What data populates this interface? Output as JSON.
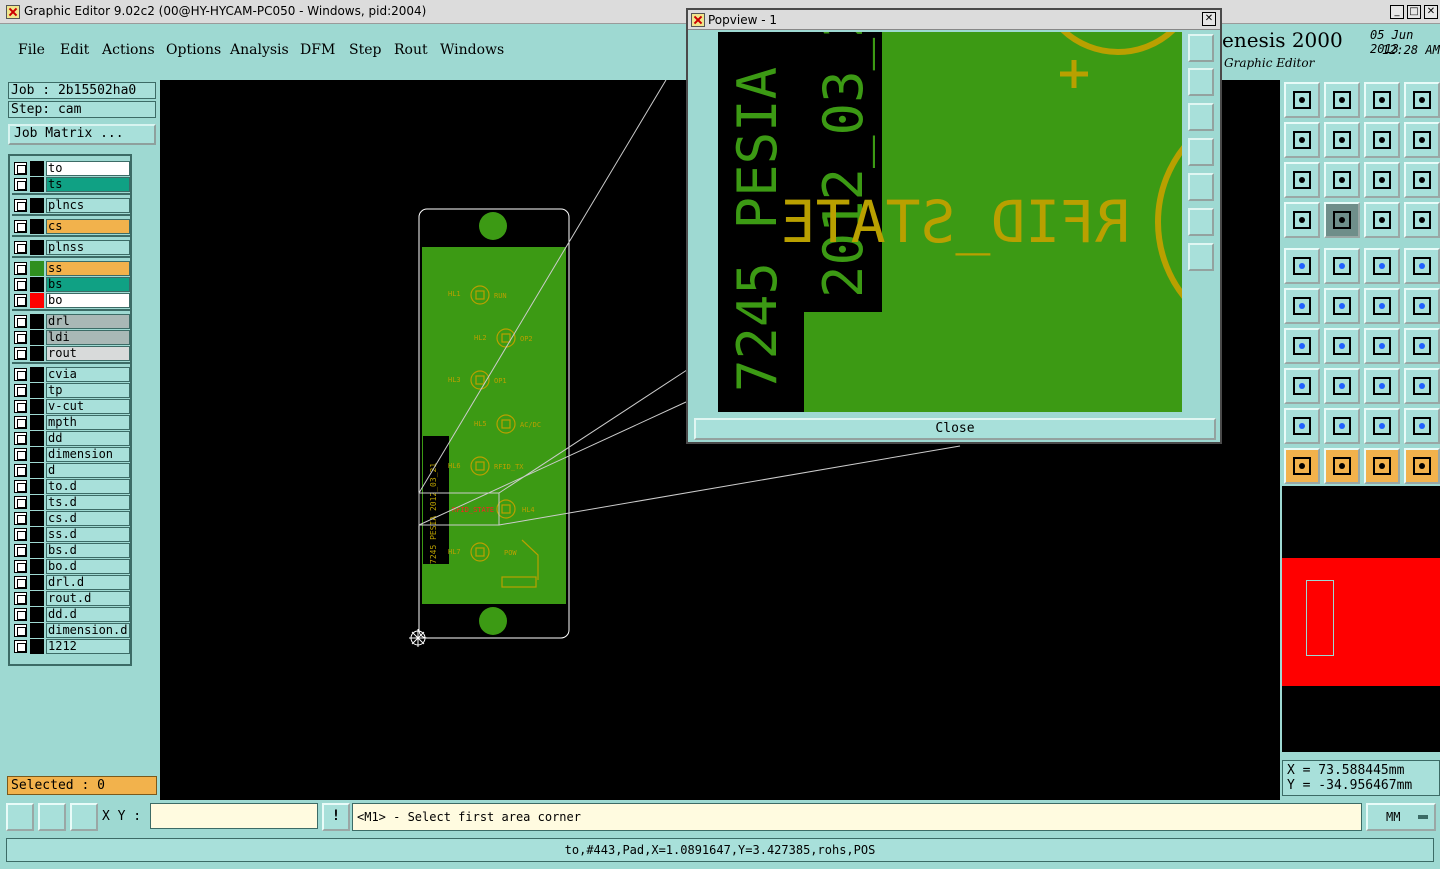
{
  "window": {
    "title": "Graphic Editor 9.02c2 (00@HY-HYCAM-PC050 - Windows, pid:2004)",
    "min": "_",
    "max": "□",
    "close": "✕"
  },
  "menu": {
    "items": [
      "File",
      "Edit",
      "Actions",
      "Options",
      "Analysis",
      "DFM",
      "Step",
      "Rout",
      "Windows"
    ]
  },
  "brand": {
    "name": "enesis 2000",
    "sub": "Graphic Editor",
    "date": "05 Jun 2013",
    "time": "12:28 AM"
  },
  "left": {
    "job": "Job : 2b15502ha0",
    "step": "Step: cam",
    "job_matrix": "Job Matrix ...",
    "selected": "Selected : 0"
  },
  "layers": [
    {
      "name": "to",
      "color": "#000000",
      "bg": "#ffffff"
    },
    {
      "name": "ts",
      "color": "#000000",
      "bg": "#10a184"
    },
    {
      "name": "plncs",
      "color": "#000000",
      "bg": "#a8e0da"
    },
    {
      "name": "cs",
      "color": "#000000",
      "bg": "#f2b24c"
    },
    {
      "name": "plnss",
      "color": "#000000",
      "bg": "#a8e0da"
    },
    {
      "name": "ss",
      "color": "#2f8f1f",
      "bg": "#f2b24c"
    },
    {
      "name": "bs",
      "color": "#000000",
      "bg": "#10a184"
    },
    {
      "name": "bo",
      "color": "#ff0000",
      "bg": "#ffffff"
    },
    {
      "name": "drl",
      "color": "#000000",
      "bg": "#a9b8b6"
    },
    {
      "name": "ldi",
      "color": "#000000",
      "bg": "#a9b8b6"
    },
    {
      "name": "rout",
      "color": "#000000",
      "bg": "#d8dada"
    },
    {
      "name": "cvia",
      "color": "#000000",
      "bg": "#a8e0da"
    },
    {
      "name": "tp",
      "color": "#000000",
      "bg": "#a8e0da"
    },
    {
      "name": "v-cut",
      "color": "#000000",
      "bg": "#a8e0da"
    },
    {
      "name": "mpth",
      "color": "#000000",
      "bg": "#a8e0da"
    },
    {
      "name": "dd",
      "color": "#000000",
      "bg": "#a8e0da"
    },
    {
      "name": "dimension",
      "color": "#000000",
      "bg": "#a8e0da"
    },
    {
      "name": "d",
      "color": "#000000",
      "bg": "#a8e0da"
    },
    {
      "name": "to.d",
      "color": "#000000",
      "bg": "#a8e0da"
    },
    {
      "name": "ts.d",
      "color": "#000000",
      "bg": "#a8e0da"
    },
    {
      "name": "cs.d",
      "color": "#000000",
      "bg": "#a8e0da"
    },
    {
      "name": "ss.d",
      "color": "#000000",
      "bg": "#a8e0da"
    },
    {
      "name": "bs.d",
      "color": "#000000",
      "bg": "#a8e0da"
    },
    {
      "name": "bo.d",
      "color": "#000000",
      "bg": "#a8e0da"
    },
    {
      "name": "drl.d",
      "color": "#000000",
      "bg": "#a8e0da"
    },
    {
      "name": "rout.d",
      "color": "#000000",
      "bg": "#a8e0da"
    },
    {
      "name": "dd.d",
      "color": "#000000",
      "bg": "#a8e0da"
    },
    {
      "name": "dimension.d",
      "color": "#000000",
      "bg": "#a8e0da"
    },
    {
      "name": "1212",
      "color": "#000000",
      "bg": "#a8e0da"
    }
  ],
  "board": {
    "silk": [
      "RUN",
      "OP2",
      "OP1",
      "AC/DC",
      "RFID_TX",
      "RFID_STATE",
      "POW"
    ],
    "refs": [
      "HL1",
      "HL2",
      "HL3",
      "HL5",
      "HL6",
      "HL4",
      "HL7"
    ],
    "vert_text": [
      "7245 PESIA 2012_03_21",
      "2012_03_21"
    ]
  },
  "popview": {
    "title": "Popview - 1",
    "close": "Close",
    "text_vert1": "7245 PESIA",
    "text_vert2": "2012_03_21",
    "mirror_text": "RFID_STATE"
  },
  "coords": {
    "x": "X = 73.588445mm",
    "y": "Y = -34.956467mm"
  },
  "cmd": {
    "xy_label": "X Y :",
    "xy_value": "",
    "prompt": "<M1> - Select first area corner",
    "units": "MM",
    "bang": "!"
  },
  "status": {
    "text": "to,#443,Pad,X=1.0891647,Y=3.427385,rohs,POS"
  },
  "colors": {
    "board_green": "#3c9a14",
    "silk_yellow": "#b9a000",
    "highlight_red": "#ff2020",
    "ui_cyan": "#9ed9d2",
    "minimap_red": "#ff0000"
  }
}
